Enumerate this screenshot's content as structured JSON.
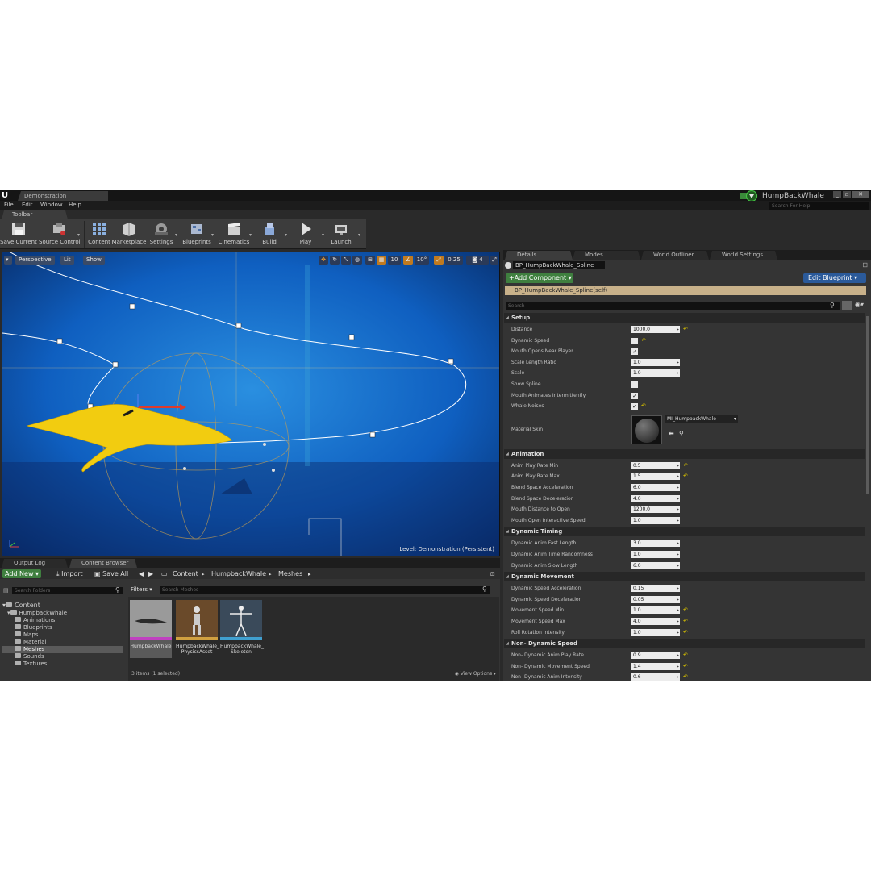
{
  "window": {
    "document_tab": "Demonstration",
    "project_name": "HumpBackWhale",
    "help_search_placeholder": "Search For Help"
  },
  "menu": [
    "File",
    "Edit",
    "Window",
    "Help"
  ],
  "toolbar": {
    "tab_label": "Toolbar",
    "buttons": [
      "Save Current",
      "Source Control",
      "Content",
      "Marketplace",
      "Settings",
      "Blueprints",
      "Cinematics",
      "Build",
      "Play",
      "Launch"
    ]
  },
  "viewport": {
    "perspective_label": "Perspective",
    "lit_label": "Lit",
    "show_label": "Show",
    "grid_snap": "10",
    "rotation_snap": "10°",
    "scale_snap": "0.25",
    "camera_speed": "4",
    "level_prefix": "Level:",
    "level_name": "Demonstration (Persistent)"
  },
  "details_tabs": [
    "Details",
    "Modes",
    "World Outliner",
    "World Settings"
  ],
  "details": {
    "actor_name": "BP_HumpBackWhale_Spline",
    "add_component": "+Add Component ▾",
    "edit_blueprint": "Edit Blueprint ▾",
    "self_row": "BP_HumpBackWhale_Spline(self)",
    "search_placeholder": "Search",
    "sections": {
      "setup": "Setup",
      "animation": "Animation",
      "dynamic_timing": "Dynamic Timing",
      "dynamic_movement": "Dynamic Movement",
      "non_dynamic_speed": "Non- Dynamic Speed"
    },
    "setup": {
      "distance": {
        "label": "Distance",
        "value": "1000.0"
      },
      "dynamic_speed": {
        "label": "Dynamic Speed"
      },
      "mouth_opens": {
        "label": "Mouth Opens Near Player"
      },
      "scale_length_ratio": {
        "label": "Scale Length Ratio",
        "value": "1.0"
      },
      "scale": {
        "label": "Scale",
        "value": "1.0"
      },
      "show_spline": {
        "label": "Show Spline"
      },
      "mouth_animates": {
        "label": "Mouth Animates Intermittently"
      },
      "whale_noises": {
        "label": "Whale Noises"
      },
      "material_skin": {
        "label": "Material Skin",
        "value": "MI_HumpbackWhale"
      }
    },
    "animation": [
      {
        "label": "Anim Play Rate Min",
        "value": "0.5",
        "reset": true
      },
      {
        "label": "Anim Play Rate Max",
        "value": "1.5",
        "reset": true
      },
      {
        "label": "Blend Space Acceleration",
        "value": "6.0",
        "reset": false
      },
      {
        "label": "Blend Space Deceleration",
        "value": "4.0",
        "reset": false
      },
      {
        "label": "Mouth Distance to Open",
        "value": "1200.0",
        "reset": false
      },
      {
        "label": "Mouth Open Interactive Speed",
        "value": "1.0",
        "reset": false
      }
    ],
    "dynamic_timing": [
      {
        "label": "Dynamic Anim Fast Length",
        "value": "3.0",
        "reset": false
      },
      {
        "label": "Dynamic Anim Time Randomness",
        "value": "1.0",
        "reset": false
      },
      {
        "label": "Dynamic Anim Slow Length",
        "value": "6.0",
        "reset": false
      }
    ],
    "dynamic_movement": [
      {
        "label": "Dynamic Speed Acceleration",
        "value": "0.15",
        "reset": false
      },
      {
        "label": "Dynamic Speed Deceleration",
        "value": "0.05",
        "reset": false
      },
      {
        "label": "Movement Speed Min",
        "value": "1.0",
        "reset": true
      },
      {
        "label": "Movement Speed Max",
        "value": "4.0",
        "reset": true
      },
      {
        "label": "Roll Rotation Intensity",
        "value": "1.0",
        "reset": true
      }
    ],
    "non_dynamic_speed": [
      {
        "label": "Non- Dynamic Anim Play Rate",
        "value": "0.9",
        "reset": true
      },
      {
        "label": "Non- Dynamic Movement Speed",
        "value": "1.4",
        "reset": true
      },
      {
        "label": "Non- Dynamic Anim Intensity",
        "value": "0.6",
        "reset": true
      }
    ]
  },
  "bottom_tabs": [
    "Output Log",
    "Content Browser"
  ],
  "content_browser": {
    "add_new": "Add New ▾",
    "import": "Import",
    "save_all": "Save All",
    "breadcrumbs": [
      "Content",
      "HumpbackWhale",
      "Meshes"
    ],
    "filters": "Filters ▾",
    "search_folders_placeholder": "Search Folders",
    "search_meshes_placeholder": "Search Meshes",
    "folders": {
      "root": "Content",
      "project": "HumpbackWhale",
      "children": [
        "Animations",
        "Blueprints",
        "Maps",
        "Material",
        "Meshes",
        "Sounds",
        "Textures"
      ]
    },
    "assets": [
      {
        "line1": "HumpbackWhale",
        "line2": ""
      },
      {
        "line1": "HumpbackWhale_",
        "line2": "PhysicsAsset"
      },
      {
        "line1": "HumpbackWhale_",
        "line2": "Skeleton"
      }
    ],
    "items_count": "3 items (1 selected)",
    "view_options": "View Options ▾"
  }
}
